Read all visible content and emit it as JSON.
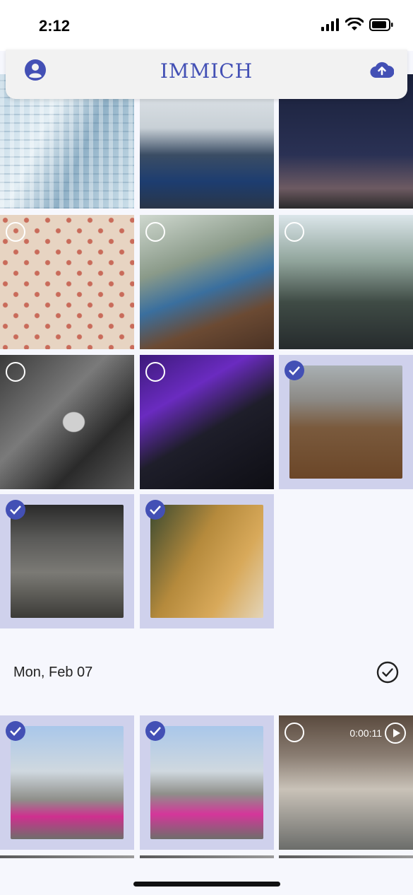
{
  "status_bar": {
    "time": "2:12"
  },
  "app_bar": {
    "title": "IMMICH",
    "profile_icon": "account-circle-icon",
    "upload_icon": "cloud-upload-icon",
    "accent_color": "#4350b5"
  },
  "groups": [
    {
      "date_label": "",
      "tiles": [
        {
          "name": "photo-building",
          "selected": false
        },
        {
          "name": "photo-venice-gondolas",
          "selected": false
        },
        {
          "name": "photo-night-satellite-dish",
          "selected": false
        },
        {
          "name": "photo-floral-wallpaper",
          "selected": false
        },
        {
          "name": "photo-yoga-stretch",
          "selected": false
        },
        {
          "name": "photo-train-passengers",
          "selected": false
        },
        {
          "name": "photo-airplane-forest",
          "selected": false
        },
        {
          "name": "photo-desk-monitor",
          "selected": false
        },
        {
          "name": "photo-child-leaves",
          "selected": true
        },
        {
          "name": "photo-suv-garage",
          "selected": true
        },
        {
          "name": "photo-dumbbell",
          "selected": true
        }
      ]
    },
    {
      "date_label": "Mon, Feb 07",
      "tiles": [
        {
          "name": "photo-toddler-pink-car-1",
          "selected": true
        },
        {
          "name": "photo-toddler-pink-car-2",
          "selected": true
        },
        {
          "name": "video-toddler-walking",
          "selected": false,
          "video_duration": "0:00:11"
        }
      ]
    }
  ],
  "selected_color": "#cfd1ec"
}
